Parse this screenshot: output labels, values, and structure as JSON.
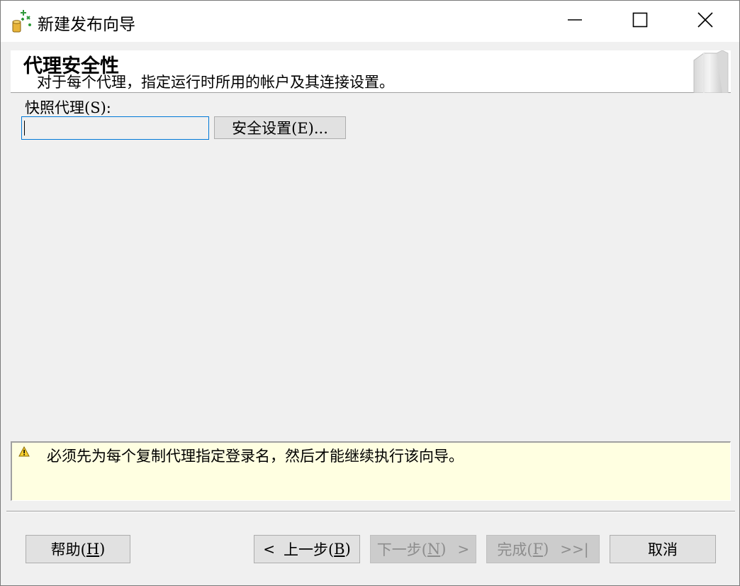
{
  "window": {
    "title": "新建发布向导",
    "minimize_icon": "minimize-icon",
    "maximize_icon": "maximize-icon",
    "close_icon": "close-icon"
  },
  "header": {
    "title": "代理安全性",
    "subtitle": "对于每个代理，指定运行时所用的帐户及其连接设置。"
  },
  "form": {
    "snapshot_agent_label": "快照代理(S):",
    "snapshot_agent_value": "",
    "security_settings_button": "安全设置(E)..."
  },
  "warning": {
    "icon": "warning-icon",
    "message": "必须先为每个复制代理指定登录名，然后才能继续执行该向导。",
    "background": "#ffffe1"
  },
  "buttons": {
    "help": {
      "text": "帮助(",
      "key": "H",
      "close": ")"
    },
    "back": {
      "arrow": "<",
      "text": "上一步(",
      "key": "B",
      "close": ")"
    },
    "next": {
      "text": "下一步(",
      "key": "N",
      "close": ")",
      "arrow": ">",
      "disabled": true
    },
    "finish": {
      "text": "完成(",
      "key": "F",
      "close": ")",
      "arrow": ">>|",
      "disabled": true
    },
    "cancel": {
      "text": "取消"
    }
  }
}
